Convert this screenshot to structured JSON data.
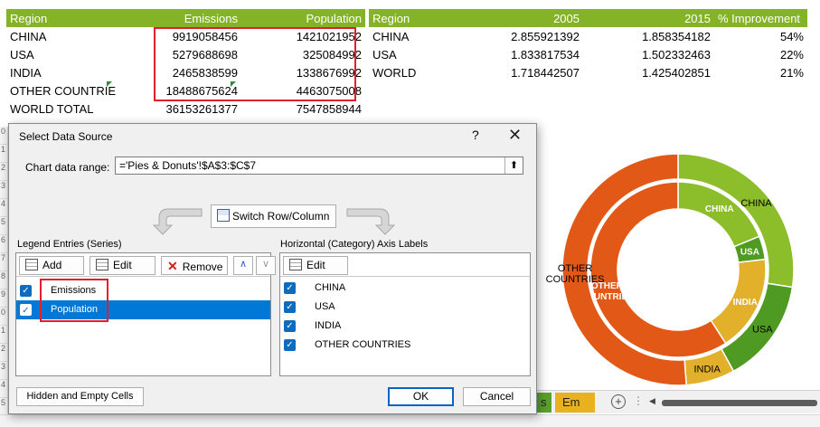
{
  "table1": {
    "headers": [
      "Region",
      "Emissions",
      "Population"
    ],
    "rows": [
      [
        "CHINA",
        "9919058456",
        "1421021952"
      ],
      [
        "USA",
        "5279688698",
        "325084992"
      ],
      [
        "INDIA",
        "2465838599",
        "1338676992"
      ],
      [
        "OTHER COUNTRIE",
        "18488675624",
        "4463075008"
      ],
      [
        "WORLD TOTAL",
        "36153261377",
        "7547858944"
      ]
    ]
  },
  "table2": {
    "headers": [
      "Region",
      "2005",
      "2015",
      "% Improvement"
    ],
    "rows": [
      [
        "CHINA",
        "2.855921392",
        "1.858354182",
        "54%"
      ],
      [
        "USA",
        "1.833817534",
        "1.502332463",
        "22%"
      ],
      [
        "WORLD",
        "1.718442507",
        "1.425402851",
        "21%"
      ]
    ]
  },
  "chart_data": {
    "type": "donut",
    "categories": [
      "CHINA",
      "USA",
      "INDIA",
      "OTHER COUNTRIES"
    ],
    "series": [
      {
        "name": "Emissions",
        "values": [
          9919058456,
          5279688698,
          2465838599,
          18488675624
        ]
      },
      {
        "name": "Population",
        "values": [
          1421021952,
          325084992,
          1338676992,
          4463075008
        ]
      }
    ],
    "inner_labels": [
      "CHINA",
      "USA",
      "INDIA",
      "OTHER COUNTRIES"
    ],
    "outer_labels": [
      "CHINA",
      "USA",
      "INDIA",
      "OTHER COUNTRIES"
    ],
    "colors": [
      "#8cbd2a",
      "#4e9a23",
      "#e2b02a",
      "#e15817"
    ]
  },
  "dialog": {
    "title": "Select Data Source",
    "help": "?",
    "close": "✕",
    "range_label": "Chart data range:",
    "range_value": "='Pies & Donuts'!$A$3:$C$7",
    "switch_label": "Switch Row/Column",
    "legend_label": "Legend Entries (Series)",
    "axis_label": "Horizontal (Category) Axis Labels",
    "add": "Add",
    "edit": "Edit",
    "remove": "Remove",
    "move_up": "∧",
    "move_down": "∨",
    "series_items": [
      "Emissions",
      "Population"
    ],
    "category_items": [
      "CHINA",
      "USA",
      "INDIA",
      "OTHER COUNTRIES"
    ],
    "hidden_cells": "Hidden and Empty Cells",
    "ok": "OK",
    "cancel": "Cancel"
  },
  "sheet_tabs": [
    "s",
    "Em"
  ],
  "colors": {
    "header_green": "#84b327",
    "highlight_red": "#e0202a",
    "selection_blue": "#0078d7"
  }
}
